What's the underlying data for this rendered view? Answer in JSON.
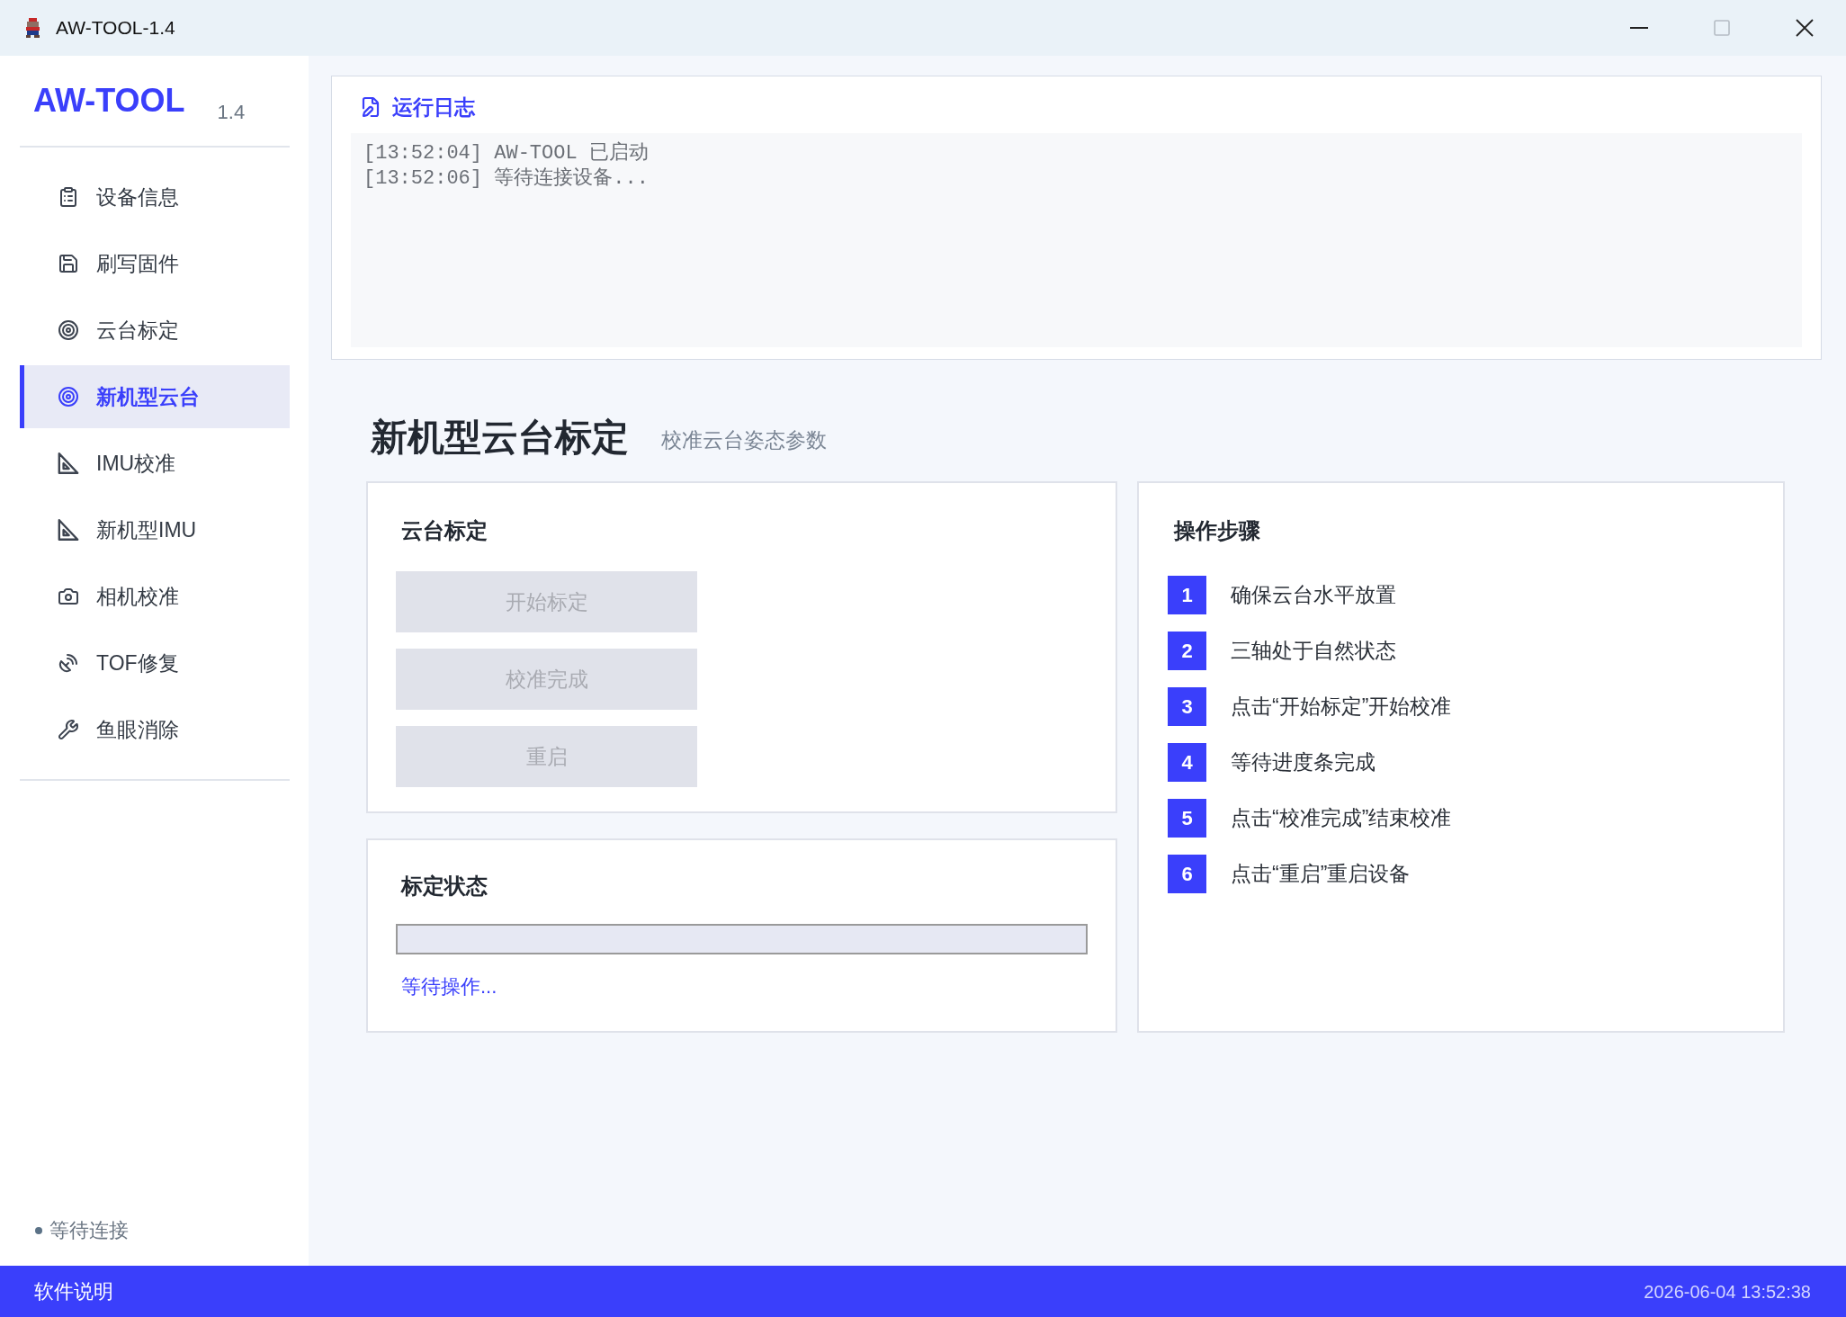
{
  "window": {
    "title": "AW-TOOL-1.4",
    "maximize_disabled": true
  },
  "sidebar": {
    "logo": "AW-TOOL",
    "version": "1.4",
    "items": [
      {
        "label": "设备信息",
        "selected": false
      },
      {
        "label": "刷写固件",
        "selected": false
      },
      {
        "label": "云台标定",
        "selected": false
      },
      {
        "label": "新机型云台",
        "selected": true
      },
      {
        "label": "IMU校准",
        "selected": false
      },
      {
        "label": "新机型IMU",
        "selected": false
      },
      {
        "label": "相机校准",
        "selected": false
      },
      {
        "label": "TOF修复",
        "selected": false
      },
      {
        "label": "鱼眼消除",
        "selected": false
      }
    ],
    "connection_status": "等待连接"
  },
  "log": {
    "title": "运行日志",
    "lines": [
      "[13:52:04] AW-TOOL 已启动",
      "[13:52:06] 等待连接设备..."
    ]
  },
  "page": {
    "title": "新机型云台标定",
    "subtitle": "校准云台姿态参数"
  },
  "calibration": {
    "title": "云台标定",
    "buttons": [
      {
        "label": "开始标定",
        "disabled": true
      },
      {
        "label": "校准完成",
        "disabled": true
      },
      {
        "label": "重启",
        "disabled": true
      }
    ]
  },
  "status": {
    "title": "标定状态",
    "progress": {
      "level": 0
    },
    "message": "等待操作..."
  },
  "steps": {
    "title": "操作步骤",
    "items": [
      {
        "number": "1",
        "text": "确保云台水平放置"
      },
      {
        "number": "2",
        "text": "三轴处于自然状态"
      },
      {
        "number": "3",
        "text": "点击“开始标定”开始校准"
      },
      {
        "number": "4",
        "text": "等待进度条完成"
      },
      {
        "number": "5",
        "text": "点击“校准完成”结束校准"
      },
      {
        "number": "6",
        "text": "点击“重启”重启设备"
      }
    ]
  },
  "status_bar": {
    "help": "软件说明",
    "datetime": "2026-06-04 13:52:38"
  }
}
